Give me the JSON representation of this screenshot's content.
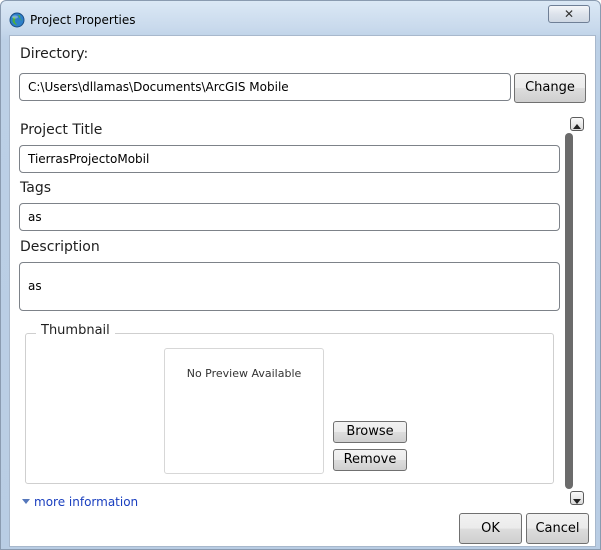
{
  "window": {
    "title": "Project Properties",
    "close_glyph": "✕"
  },
  "directory": {
    "label": "Directory:",
    "value": "C:\\Users\\dllamas\\Documents\\ArcGIS Mobile",
    "change_label": "Change"
  },
  "project_title": {
    "label": "Project Title",
    "value": "TierrasProjectoMobil"
  },
  "tags": {
    "label": "Tags",
    "value": "as"
  },
  "description": {
    "label": "Description",
    "value": "as"
  },
  "thumbnail": {
    "legend": "Thumbnail",
    "preview_text": "No Preview Available",
    "browse_label": "Browse",
    "remove_label": "Remove"
  },
  "footer": {
    "more_information": "more information",
    "ok_label": "OK",
    "cancel_label": "Cancel"
  },
  "colors": {
    "accent_link": "#1a3fbf",
    "title_bar": "#c8d9ec"
  }
}
